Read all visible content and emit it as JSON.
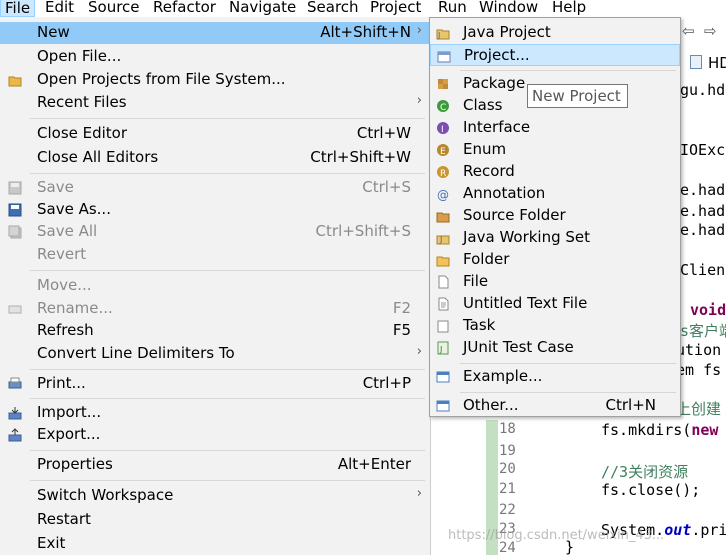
{
  "menubar": [
    "File",
    "Edit",
    "Source",
    "Refactor",
    "Navigate",
    "Search",
    "Project",
    "Run",
    "Window",
    "Help"
  ],
  "file_menu": {
    "new": {
      "label": "New",
      "accel": "Alt+Shift+N"
    },
    "open_file": "Open File...",
    "open_projects": "Open Projects from File System...",
    "recent_files": "Recent Files",
    "close_editor": {
      "label": "Close Editor",
      "accel": "Ctrl+W"
    },
    "close_all": {
      "label": "Close All Editors",
      "accel": "Ctrl+Shift+W"
    },
    "save": {
      "label": "Save",
      "accel": "Ctrl+S"
    },
    "save_as": "Save As...",
    "save_all": {
      "label": "Save All",
      "accel": "Ctrl+Shift+S"
    },
    "revert": "Revert",
    "move": "Move...",
    "rename": {
      "label": "Rename...",
      "accel": "F2"
    },
    "refresh": {
      "label": "Refresh",
      "accel": "F5"
    },
    "convert": "Convert Line Delimiters To",
    "print": {
      "label": "Print...",
      "accel": "Ctrl+P"
    },
    "import": "Import...",
    "export": "Export...",
    "properties": {
      "label": "Properties",
      "accel": "Alt+Enter"
    },
    "switch_workspace": "Switch Workspace",
    "restart": "Restart",
    "exit": "Exit"
  },
  "new_submenu": {
    "items": [
      "Java Project",
      "Project...",
      "Package",
      "Class",
      "Interface",
      "Enum",
      "Record",
      "Annotation",
      "Source Folder",
      "Java Working Set",
      "Folder",
      "File",
      "Untitled Text File",
      "Task",
      "JUnit Test Case"
    ],
    "example": "Example...",
    "other": {
      "label": "Other...",
      "accel": "Ctrl+N"
    }
  },
  "tooltip": "New Project",
  "editor": {
    "tab": "HD",
    "lines": [
      "gu.hd",
      "IOExcep",
      "e.hado",
      "e.hado",
      "e.hado",
      "Clien"
    ],
    "void_kw": "void",
    "chinese_comment": "s客户端",
    "ution": "ution",
    "em_fs": "em fs",
    "create_comment": "上创建",
    "line_numbers": [
      "18",
      "19",
      "20",
      "21",
      "22",
      "23",
      "24"
    ],
    "mkdirs": "fs.mkdirs(",
    "new_kw": "new",
    "close_comment": "//3关闭资源",
    "close_call": "fs.close();",
    "println_pre": "System.",
    "println_field": "out",
    "println_post": ".pri"
  },
  "watermark": "https://blog.csdn.net/weixin_43..."
}
